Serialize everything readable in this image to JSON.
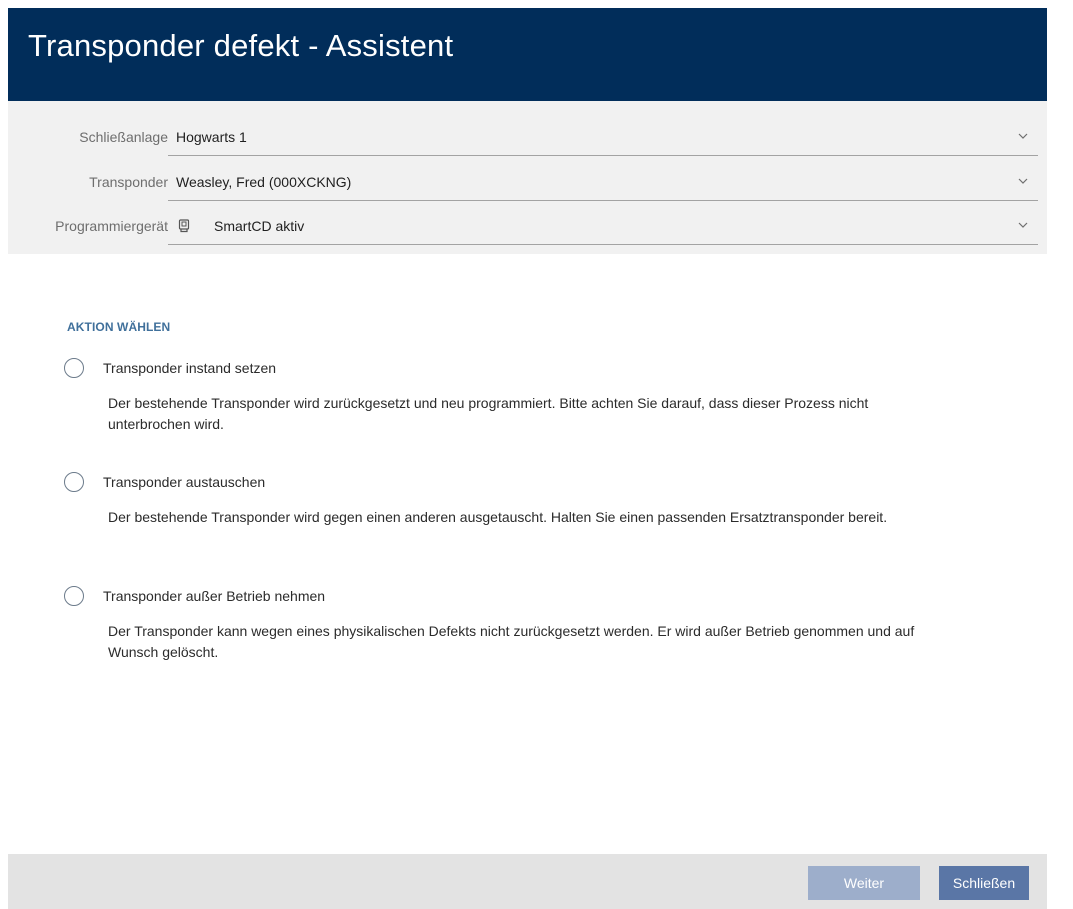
{
  "window": {
    "title": "Transponder defekt - Assistent"
  },
  "settings": {
    "locking_system": {
      "label": "Schließanlage",
      "value": "Hogwarts 1"
    },
    "transponder": {
      "label": "Transponder",
      "value": "Weasley, Fred (000XCKNG)"
    },
    "programming_device": {
      "label": "Programmiergerät",
      "value": "SmartCD aktiv",
      "icon": "smartcd-device-icon"
    }
  },
  "action": {
    "heading": "AKTION WÄHLEN",
    "options": [
      {
        "label": "Transponder instand setzen",
        "description": "Der bestehende Transponder wird zurückgesetzt und neu programmiert. Bitte achten Sie darauf, dass dieser Prozess nicht unterbrochen wird.",
        "selected": false
      },
      {
        "label": "Transponder austauschen",
        "description": "Der bestehende Transponder wird gegen einen anderen ausgetauscht. Halten Sie einen passenden Ersatztransponder bereit.",
        "selected": false
      },
      {
        "label": "Transponder außer Betrieb nehmen",
        "description": "Der Transponder kann wegen eines physikalischen Defekts nicht zurückgesetzt werden. Er wird außer Betrieb genommen und auf Wunsch gelöscht.",
        "selected": false
      }
    ]
  },
  "footer": {
    "next_label": "Weiter",
    "close_label": "Schließen"
  },
  "colors": {
    "titlebar": "#012d5a",
    "heading_accent": "#40709b",
    "button_disabled": "#9daecb",
    "button_primary": "#5a76a6"
  }
}
